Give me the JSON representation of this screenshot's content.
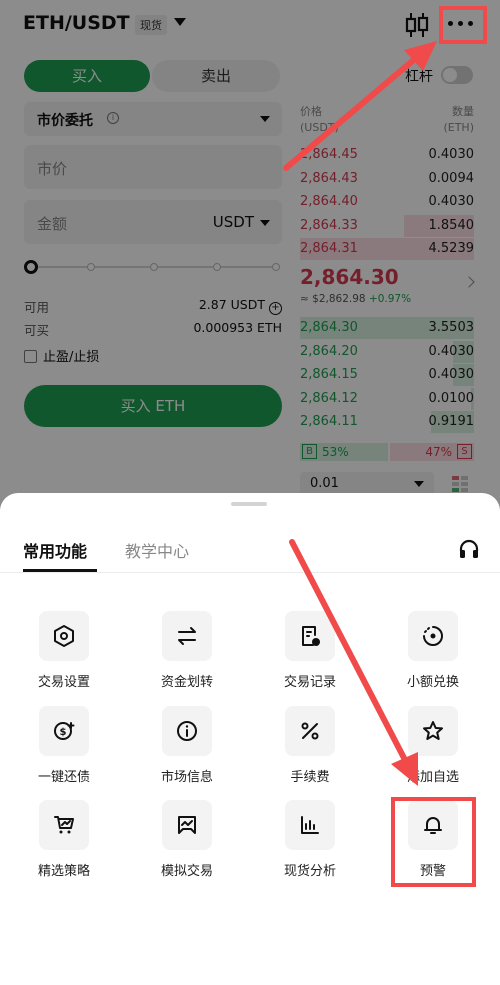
{
  "header": {
    "pair": "ETH/USDT",
    "market_tag": "现货"
  },
  "trade": {
    "buy_tab": "买入",
    "sell_tab": "卖出",
    "leverage_label": "杠杆",
    "order_type": "市价委托",
    "price_placeholder": "市价",
    "amount_placeholder": "金额",
    "amount_unit": "USDT",
    "available_label": "可用",
    "available_value": "2.87 USDT",
    "buyable_label": "可买",
    "buyable_value": "0.000953 ETH",
    "tpsl_label": "止盈/止损",
    "buy_button": "买入 ETH",
    "slider_value_percent": 0
  },
  "orderbook": {
    "price_header": "价格",
    "price_unit": "(USDT)",
    "qty_header": "数量",
    "qty_unit": "(ETH)",
    "asks": [
      {
        "price": "2,864.45",
        "qty": "0.4030",
        "depth": 0
      },
      {
        "price": "2,864.43",
        "qty": "0.0094",
        "depth": 0
      },
      {
        "price": "2,864.40",
        "qty": "0.4030",
        "depth": 0
      },
      {
        "price": "2,864.33",
        "qty": "1.8540",
        "depth": 0.4
      },
      {
        "price": "2,864.31",
        "qty": "4.5239",
        "depth": 1.0
      }
    ],
    "last_price": "2,864.30",
    "last_sub": "≈ $2,862.98",
    "last_pct": "+0.97%",
    "bids": [
      {
        "price": "2,864.30",
        "qty": "3.5503",
        "depth": 1.0
      },
      {
        "price": "2,864.20",
        "qty": "0.4030",
        "depth": 0.12
      },
      {
        "price": "2,864.15",
        "qty": "0.4030",
        "depth": 0.12
      },
      {
        "price": "2,864.12",
        "qty": "0.0100",
        "depth": 0.02
      },
      {
        "price": "2,864.11",
        "qty": "0.9191",
        "depth": 0.25
      }
    ],
    "buy_ratio_label": "B",
    "buy_ratio": "53%",
    "sell_ratio": "47%",
    "sell_ratio_label": "S",
    "depth_step": "0.01"
  },
  "sheet": {
    "tab_common": "常用功能",
    "tab_edu": "教学中心",
    "functions": [
      {
        "label": "交易设置",
        "icon": "hexagon-settings-icon"
      },
      {
        "label": "资金划转",
        "icon": "transfer-arrows-icon"
      },
      {
        "label": "交易记录",
        "icon": "trade-record-icon"
      },
      {
        "label": "小额兑换",
        "icon": "small-exchange-icon"
      },
      {
        "label": "一键还债",
        "icon": "repay-debt-icon"
      },
      {
        "label": "市场信息",
        "icon": "info-icon"
      },
      {
        "label": "手续费",
        "icon": "percent-icon"
      },
      {
        "label": "添加自选",
        "icon": "star-icon"
      },
      {
        "label": "精选策略",
        "icon": "strategy-cart-icon"
      },
      {
        "label": "模拟交易",
        "icon": "demo-trade-icon"
      },
      {
        "label": "现货分析",
        "icon": "bar-chart-icon"
      },
      {
        "label": "预警",
        "icon": "bell-icon"
      }
    ]
  },
  "colors": {
    "buy_green": "#1e9e52",
    "sell_red": "#d43a4f",
    "annotation_red": "#f04a4a"
  }
}
